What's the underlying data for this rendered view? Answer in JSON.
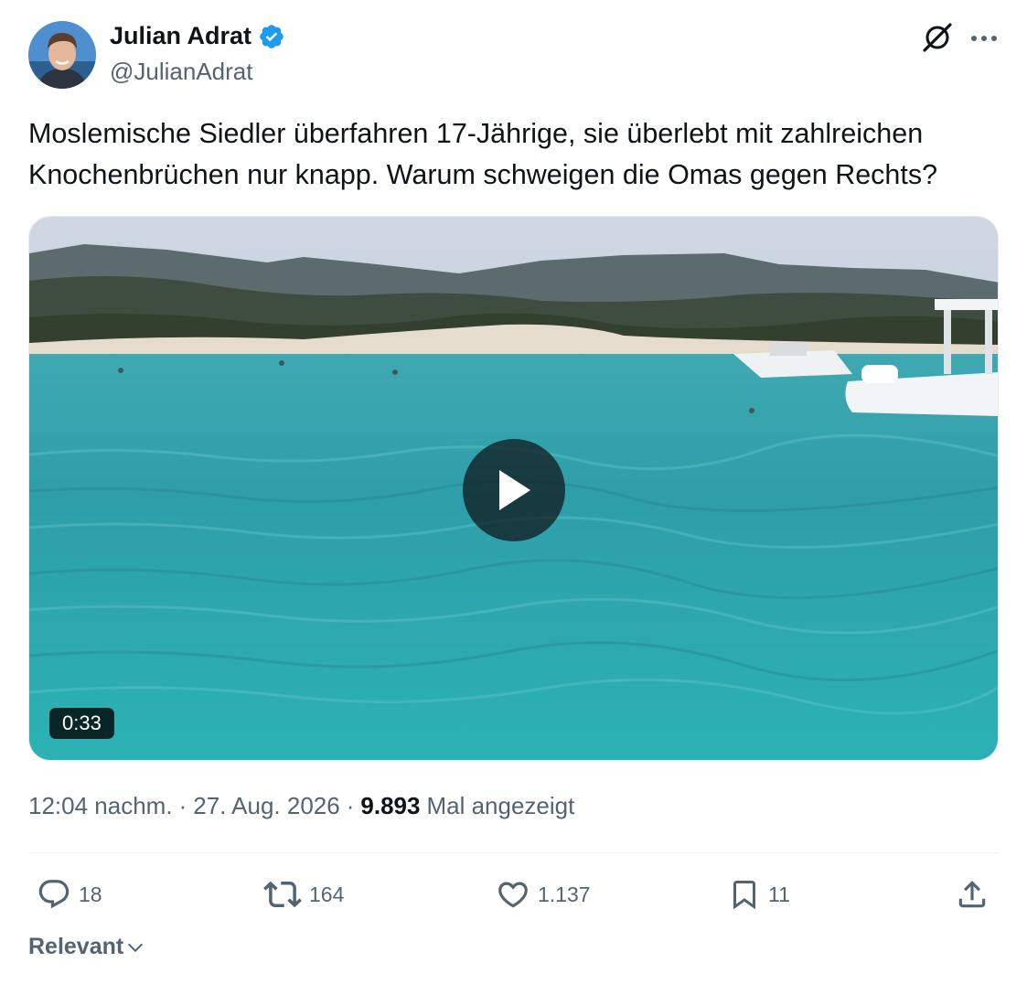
{
  "author": {
    "name": "Julian Adrat",
    "handle": "@JulianAdrat",
    "verified_color": "#1d9bf0"
  },
  "tweet": {
    "text": "Moslemische Siedler überfahren 17-Jährige, sie überlebt mit zahlreichen\nKnochenbrüchen nur knapp. Warum schweigen die Omas gegen Rechts?"
  },
  "media": {
    "type": "video",
    "duration": "0:33",
    "icon": "play-icon"
  },
  "meta": {
    "time": "12:04 nachm.",
    "separator": "·",
    "date": "27. Aug. 2026",
    "views_count": "9.893",
    "views_label": "Mal angezeigt"
  },
  "actions": {
    "replies": "18",
    "reposts": "164",
    "likes": "1.137",
    "bookmarks": "11"
  },
  "sort": {
    "label": "Relevant"
  },
  "icons": [
    "verified-badge-icon",
    "grok-icon",
    "more-icon",
    "play-icon",
    "reply-icon",
    "repost-icon",
    "like-icon",
    "bookmark-icon",
    "share-icon",
    "chevron-down-icon"
  ],
  "colors": {
    "text_primary": "#0f1419",
    "text_secondary": "#536471",
    "accent": "#1d9bf0"
  }
}
